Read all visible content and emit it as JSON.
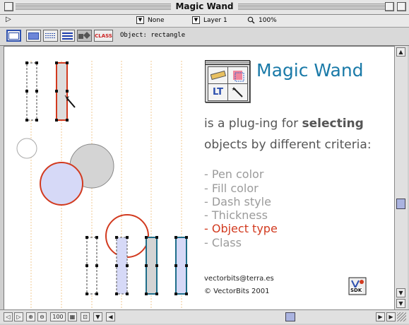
{
  "window": {
    "title": "Magic Wand"
  },
  "infobar": {
    "pen_value": "None",
    "layer_value": "Layer 1",
    "zoom_value": "100%"
  },
  "toolbar": {
    "buttons": [
      "rect-outline",
      "rect-filled",
      "dashed-lines",
      "thick-lines",
      "object-type",
      "CLASS"
    ],
    "class_label": "CLASS",
    "object_label": "Object: rectangle"
  },
  "content": {
    "plugin_name": "Magic Wand",
    "desc_prefix": "is a plug-ing for ",
    "desc_bold": "selecting",
    "desc_line2": "objects by different criteria:",
    "criteria": [
      {
        "label": "- Pen color",
        "color": "#9b9b9b"
      },
      {
        "label": "- Fill color",
        "color": "#9b9b9b"
      },
      {
        "label": "- Dash style",
        "color": "#9b9b9b"
      },
      {
        "label": "- Thickness",
        "color": "#9b9b9b"
      },
      {
        "label": "- Object type",
        "color": "#d23a1f"
      },
      {
        "label": "- Class",
        "color": "#9b9b9b"
      }
    ],
    "email": "vectorbits@terra.es",
    "copyright": "© VectorBits 2001",
    "sdk_label": "SDK",
    "logo_letters": "LT"
  },
  "statusbar": {
    "zoom_value": "100"
  },
  "colors": {
    "accent": "#1a7aa8",
    "highlight": "#d23a1f",
    "muted": "#9b9b9b",
    "guide": "#f0c890"
  }
}
